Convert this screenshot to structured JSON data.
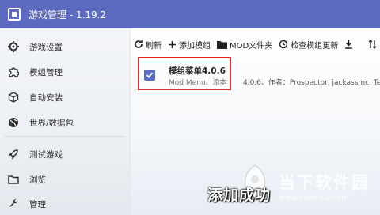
{
  "window": {
    "title": "游戏管理 - 1.19.2"
  },
  "sidebar": {
    "items": [
      {
        "label": "游戏设置",
        "icon": "gear-icon"
      },
      {
        "label": "模组管理",
        "icon": "puzzle-icon"
      },
      {
        "label": "自动安装",
        "icon": "cube-icon"
      },
      {
        "label": "世界/数据包",
        "icon": "globe-icon"
      },
      {
        "label": "测试游戏",
        "icon": "rocket-icon"
      },
      {
        "label": "浏览",
        "icon": "folder-icon"
      },
      {
        "label": "管理",
        "icon": "wrench-icon"
      }
    ]
  },
  "toolbar": {
    "refresh": "刷新",
    "add_mod": "添加模组",
    "mod_folder": "MOD文件夹",
    "check_updates": "检查模组更新"
  },
  "mods": [
    {
      "name": "模组菜单4.0.6",
      "description": "Mod Menu、添本",
      "meta": "4.0.6、作者：Prospector, jackassmc, Te",
      "checked": true
    }
  ],
  "caption": "添加成功",
  "watermark": {
    "name": "当下软件园",
    "url": "www.downxia.com"
  },
  "colors": {
    "accent": "#5c6bc0",
    "highlight": "#e02b2b"
  }
}
